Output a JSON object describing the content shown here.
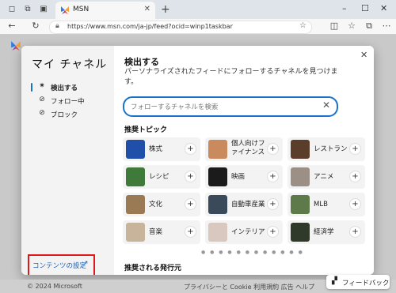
{
  "browser": {
    "tab_title": "MSN",
    "url": "https://www.msn.com/ja-jp/feed?ocid=winp1taskbar"
  },
  "modal": {
    "sidebar_title": "マイ チャネル",
    "nav": [
      {
        "label": "検出する",
        "icon": "compass-icon",
        "active": true
      },
      {
        "label": "フォロー中",
        "icon": "check-circle-icon",
        "active": false
      },
      {
        "label": "ブロック",
        "icon": "block-icon",
        "active": false
      }
    ],
    "settings_link": "コンテンツの設定",
    "main_title": "検出する",
    "description": "パーソナライズされたフィードにフォローするチャネルを見つけます。",
    "search_placeholder": "フォローするチャネルを検索",
    "recommended_topics_title": "推奨トピック",
    "topics": [
      {
        "label": "株式",
        "color": "#1f4fa8"
      },
      {
        "label": "個人向けファイナンス",
        "color": "#c98a5e"
      },
      {
        "label": "レストラン",
        "color": "#5a3d2b"
      },
      {
        "label": "レシピ",
        "color": "#3f7a3a"
      },
      {
        "label": "映画",
        "color": "#1b1b1b"
      },
      {
        "label": "アニメ",
        "color": "#9b8f86"
      },
      {
        "label": "文化",
        "color": "#9a7a55"
      },
      {
        "label": "自動車産業",
        "color": "#3a4a5a"
      },
      {
        "label": "MLB",
        "color": "#5f7a4a"
      },
      {
        "label": "音楽",
        "color": "#c8b49a"
      },
      {
        "label": "インテリア",
        "color": "#d8c8c0"
      },
      {
        "label": "経済学",
        "color": "#2f3a2a"
      }
    ],
    "recommended_publishers_title": "推奨される発行元"
  },
  "footer": {
    "copyright": "© 2024 Microsoft",
    "links": "プライバシーと Cookie   利用規約   広告   ヘルプ",
    "feedback": "フィードバック"
  },
  "colors": {
    "accent": "#1a73c8",
    "highlight_box": "#e0171b"
  }
}
